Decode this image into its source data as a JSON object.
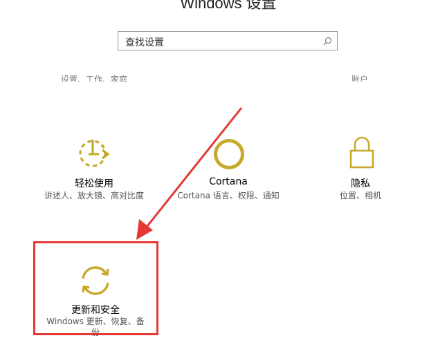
{
  "window": {
    "title": "Windows 设置"
  },
  "search": {
    "value": "查找设置"
  },
  "partial_descriptions": {
    "left": "设置、工作、家庭",
    "right": "账户"
  },
  "tiles": [
    {
      "name": "轻松使用",
      "desc": "讲述人、放大镜、高对比度",
      "icon": "accessibility-icon"
    },
    {
      "name": "Cortana",
      "desc": "Cortana 语言、权限、通知",
      "icon": "cortana-icon"
    },
    {
      "name": "隐私",
      "desc": "位置、相机",
      "icon": "lock-icon"
    },
    {
      "name": "更新和安全",
      "desc_line1": "Windows 更新、恢复、备",
      "desc_line2": "份",
      "icon": "sync-icon"
    }
  ],
  "colors": {
    "accent": "#c7a92b",
    "highlight": "#e53935",
    "arrow": "#e53935"
  }
}
